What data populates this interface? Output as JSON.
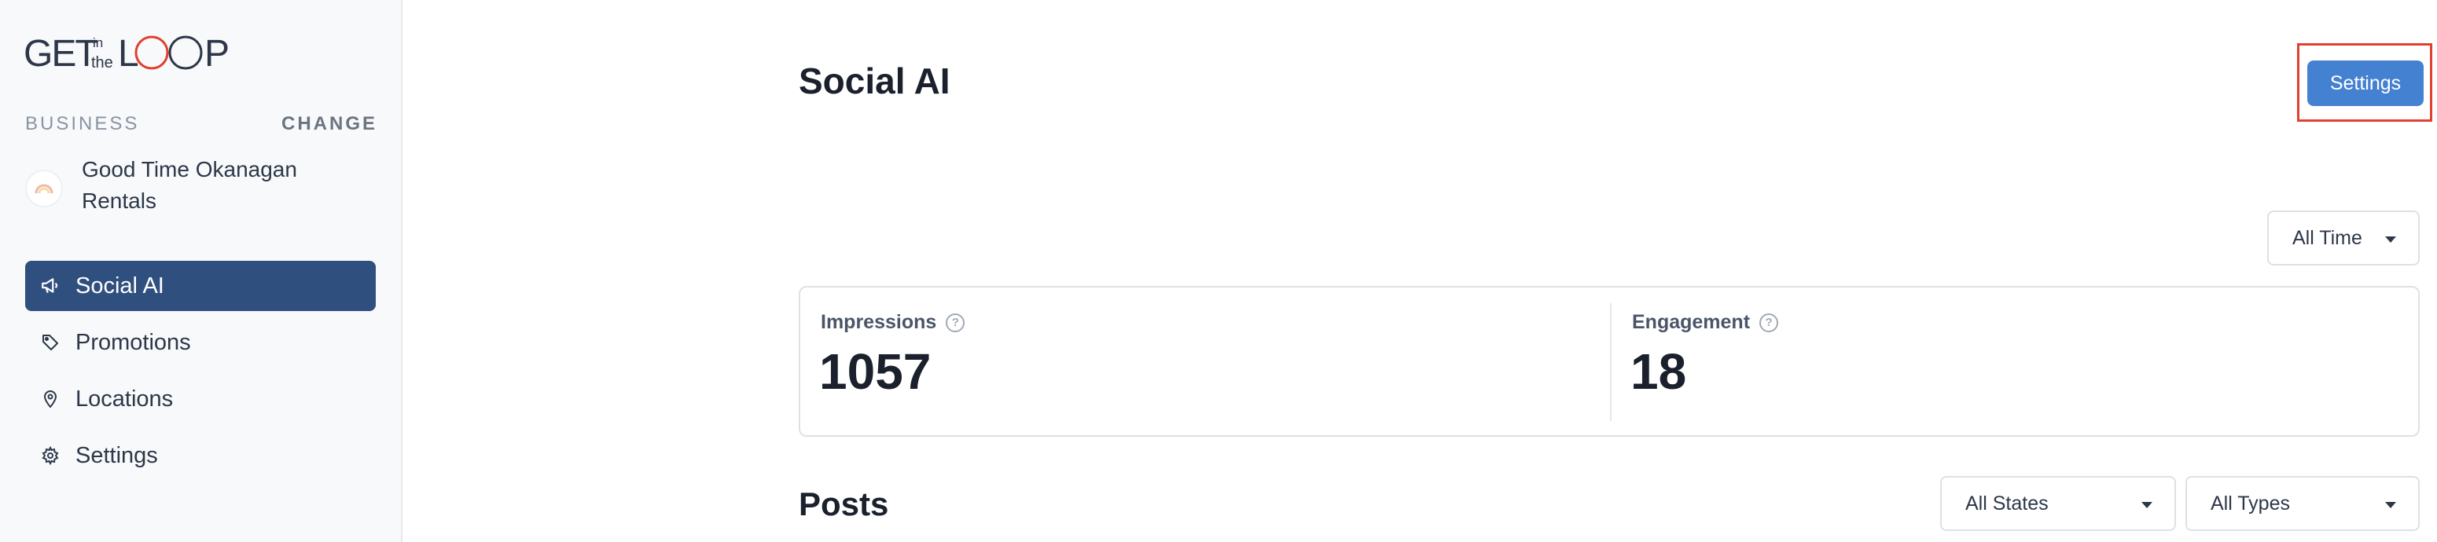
{
  "sidebar": {
    "logo_text": "GET in the LOOP",
    "business_label": "BUSINESS",
    "change_label": "CHANGE",
    "business_name": "Good Time Okanagan Rentals",
    "items": [
      {
        "label": "Social AI",
        "icon": "megaphone-icon",
        "active": true
      },
      {
        "label": "Promotions",
        "icon": "tag-icon",
        "active": false
      },
      {
        "label": "Locations",
        "icon": "map-pin-icon",
        "active": false
      },
      {
        "label": "Settings",
        "icon": "gear-icon",
        "active": false
      }
    ]
  },
  "main": {
    "title": "Social AI",
    "settings_button": "Settings",
    "time_filter": "All Time",
    "stats": [
      {
        "label": "Impressions",
        "value": "1057"
      },
      {
        "label": "Engagement",
        "value": "18"
      }
    ],
    "posts_title": "Posts",
    "state_filter": "All States",
    "type_filter": "All Types"
  },
  "colors": {
    "active_nav": "#2f4f7f",
    "button": "#4581d1",
    "highlight_border": "#e0402f",
    "logo_accent": "#e0402f"
  }
}
